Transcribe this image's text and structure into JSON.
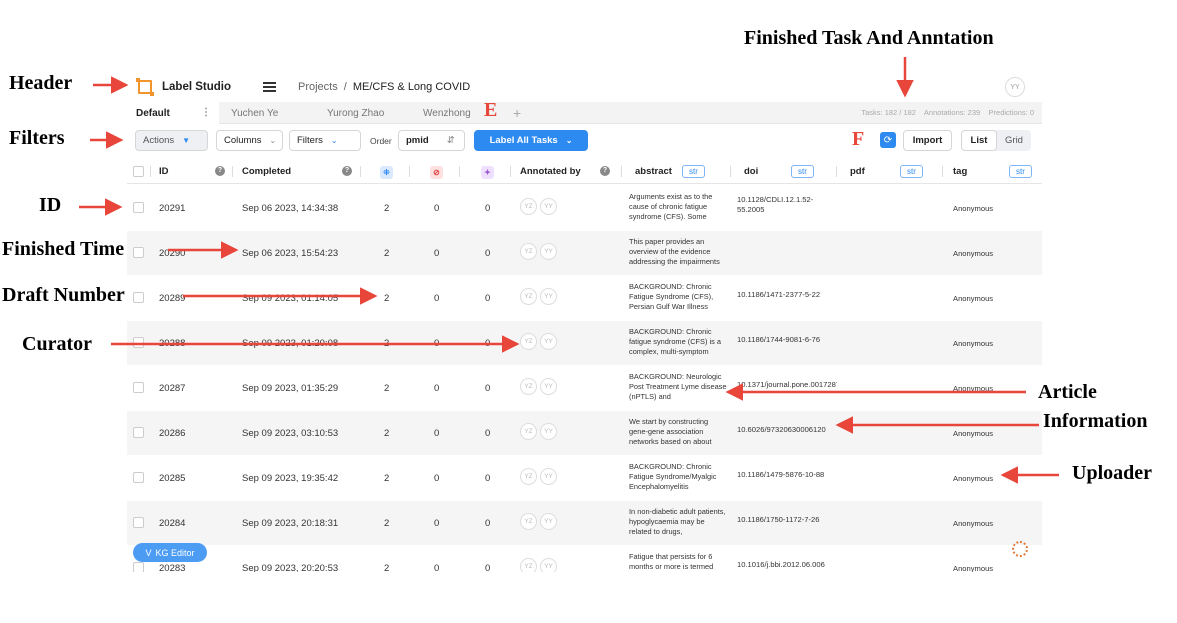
{
  "annotations": {
    "finished_task": "Finished Task And Anntation",
    "header": "Header",
    "filters": "Filters",
    "id": "ID",
    "finished_time": "Finished Time",
    "draft_number": "Draft Number",
    "curator": "Curator",
    "article": "Article",
    "information": "Information",
    "uploader": "Uploader",
    "letter_e": "E",
    "letter_f": "F"
  },
  "header": {
    "app_name": "Label Studio",
    "breadcrumb_root": "Projects",
    "breadcrumb_sep": "/",
    "project": "ME/CFS & Long COVID",
    "user_initials": "YY"
  },
  "tabs": [
    "Default",
    "Yuchen Ye",
    "Yurong Zhao",
    "Wenzhong"
  ],
  "tab_menu": "⋮",
  "tab_add": "+",
  "stats": {
    "tasks": "Tasks: 182 / 182",
    "annotations": "Annotations: 239",
    "predictions": "Predictions: 0"
  },
  "toolbar": {
    "actions": "Actions",
    "columns": "Columns",
    "filters": "Filters",
    "order_label": "Order",
    "order_field": "pmid",
    "label_all": "Label All Tasks",
    "import": "Import",
    "view_list": "List",
    "view_grid": "Grid"
  },
  "columns": {
    "id": "ID",
    "completed": "Completed",
    "annotated_by": "Annotated by",
    "abstract": "abstract",
    "doi": "doi",
    "pdf": "pdf",
    "tag": "tag",
    "type_str": "str"
  },
  "rows": [
    {
      "id": "20291",
      "completed": "Sep 06 2023, 14:34:38",
      "annotations": "2",
      "cancelled": "0",
      "predictions": "0",
      "annotators": [
        "YZ",
        "YY"
      ],
      "abstract": "Arguments exist as to the cause of chronic fatigue syndrome (CFS). Some",
      "doi": "10.1128/CDLI.12.1.52-55.2005",
      "tag": "Anonymous"
    },
    {
      "id": "20290",
      "completed": "Sep 06 2023, 15:54:23",
      "annotations": "2",
      "cancelled": "0",
      "predictions": "0",
      "annotators": [
        "YZ",
        "YY"
      ],
      "abstract": "This paper provides an overview of the evidence addressing the impairments",
      "doi": "",
      "tag": "Anonymous"
    },
    {
      "id": "20289",
      "completed": "Sep 09 2023, 01:14:05",
      "annotations": "2",
      "cancelled": "0",
      "predictions": "0",
      "annotators": [
        "YZ",
        "YY"
      ],
      "abstract": "BACKGROUND: Chronic Fatigue Syndrome (CFS), Persian Gulf War Illness",
      "doi": "10.1186/1471-2377-5-22",
      "tag": "Anonymous"
    },
    {
      "id": "20288",
      "completed": "Sep 09 2023, 01:20:08",
      "annotations": "2",
      "cancelled": "0",
      "predictions": "0",
      "annotators": [
        "YZ",
        "YY"
      ],
      "abstract": "BACKGROUND: Chronic fatigue syndrome (CFS) is a complex, multi-symptom",
      "doi": "10.1186/1744-9081-6-76",
      "tag": "Anonymous"
    },
    {
      "id": "20287",
      "completed": "Sep 09 2023, 01:35:29",
      "annotations": "2",
      "cancelled": "0",
      "predictions": "0",
      "annotators": [
        "YZ",
        "YY"
      ],
      "abstract": "BACKGROUND: Neurologic Post Treatment Lyme disease (nPTLS) and",
      "doi": "10.1371/journal.pone.0017287",
      "tag": "Anonymous"
    },
    {
      "id": "20286",
      "completed": "Sep 09 2023, 03:10:53",
      "annotations": "2",
      "cancelled": "0",
      "predictions": "0",
      "annotators": [
        "YZ",
        "YY"
      ],
      "abstract": "We start by constructing gene-gene association networks based on about",
      "doi": "10.6026/97320630006120",
      "tag": "Anonymous"
    },
    {
      "id": "20285",
      "completed": "Sep 09 2023, 19:35:42",
      "annotations": "2",
      "cancelled": "0",
      "predictions": "0",
      "annotators": [
        "YZ",
        "YY"
      ],
      "abstract": "BACKGROUND: Chronic Fatigue Syndrome/Myalgic Encephalomyelitis",
      "doi": "10.1186/1479-5876-10-88",
      "tag": "Anonymous"
    },
    {
      "id": "20284",
      "completed": "Sep 09 2023, 20:18:31",
      "annotations": "2",
      "cancelled": "0",
      "predictions": "0",
      "annotators": [
        "YZ",
        "YY"
      ],
      "abstract": "In non-diabetic adult patients, hypoglycaemia may be related to drugs,",
      "doi": "10.1186/1750-1172-7-26",
      "tag": "Anonymous"
    },
    {
      "id": "20283",
      "completed": "Sep 09 2023, 20:20:53",
      "annotations": "2",
      "cancelled": "0",
      "predictions": "0",
      "annotators": [
        "YZ",
        "YY"
      ],
      "abstract": "Fatigue that persists for 6 months or more is termed",
      "doi": "10.1016/j.bbi.2012.06.006",
      "tag": "Anonymous"
    }
  ],
  "kg_editor": "KG Editor",
  "colors": {
    "accent": "#2d8af0",
    "arrow": "#e8463a",
    "logo": "#f0942b"
  }
}
